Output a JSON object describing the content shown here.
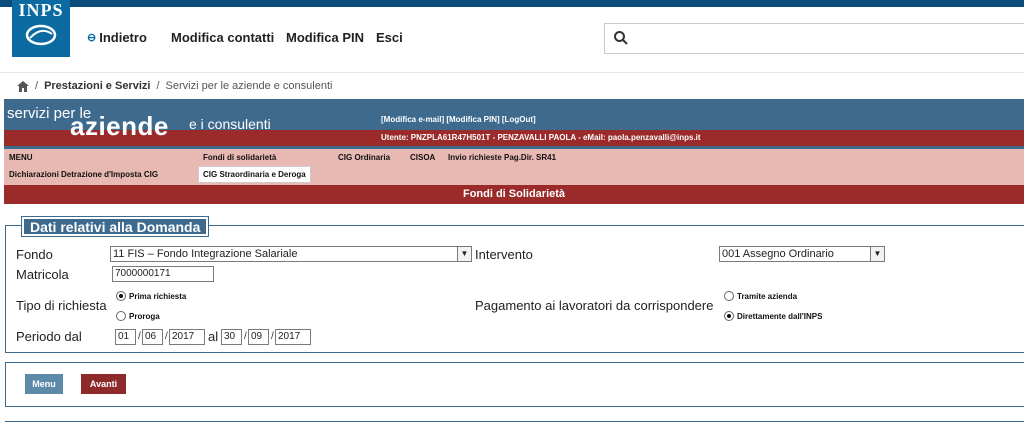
{
  "brand": {
    "logo_text": "INPS",
    "color": "#0a6aa1"
  },
  "header_nav": {
    "back": "Indietro",
    "edit_contacts": "Modifica contatti",
    "edit_pin": "Modifica PIN",
    "logout": "Esci"
  },
  "search": {
    "placeholder": ""
  },
  "breadcrumb": {
    "home_icon": "home-icon",
    "items": [
      "Prestazioni e Servizi",
      "Servizi per le aziende e consulenti"
    ]
  },
  "banner": {
    "line1": "servizi per le",
    "line2": "aziende",
    "line3": "e i consulenti",
    "links": "[Modifica e-mail]  [Modifica PIN]  [LogOut]",
    "user": "Utente: PNZPLA61R47H501T - PENZAVALLI PAOLA - eMail: paola.penzavalli@inps.it"
  },
  "menu": {
    "items": [
      "MENU",
      "Fondi di solidarietà",
      "CIG Ordinaria",
      "CISOA",
      "Invio richieste Pag.Dir. SR41",
      "Dichiarazioni Detrazione d'Imposta CIG",
      "CIG Straordinaria e Deroga"
    ]
  },
  "section": {
    "title": "Fondi di Solidarietà"
  },
  "form": {
    "legend": "Dati relativi alla Domanda",
    "fondo_label": "Fondo",
    "fondo_value": "11 FIS – Fondo Integrazione Salariale",
    "intervento_label": "Intervento",
    "intervento_value": "001 Assegno Ordinario",
    "matricola_label": "Matricola",
    "matricola_value": "7000000171",
    "tipo_label": "Tipo di richiesta",
    "tipo_options": [
      "Prima richiesta",
      "Proroga"
    ],
    "pagamento_label": "Pagamento ai lavoratori da corrispondere",
    "pagamento_options": [
      "Tramite azienda",
      "Direttamente dall'INPS"
    ],
    "periodo_label": "Periodo dal",
    "al_label": "al",
    "dal": {
      "day": "01",
      "month": "06",
      "year": "2017"
    },
    "al": {
      "day": "30",
      "month": "09",
      "year": "2017"
    }
  },
  "actions": {
    "menu": "Menu",
    "next": "Avanti"
  }
}
